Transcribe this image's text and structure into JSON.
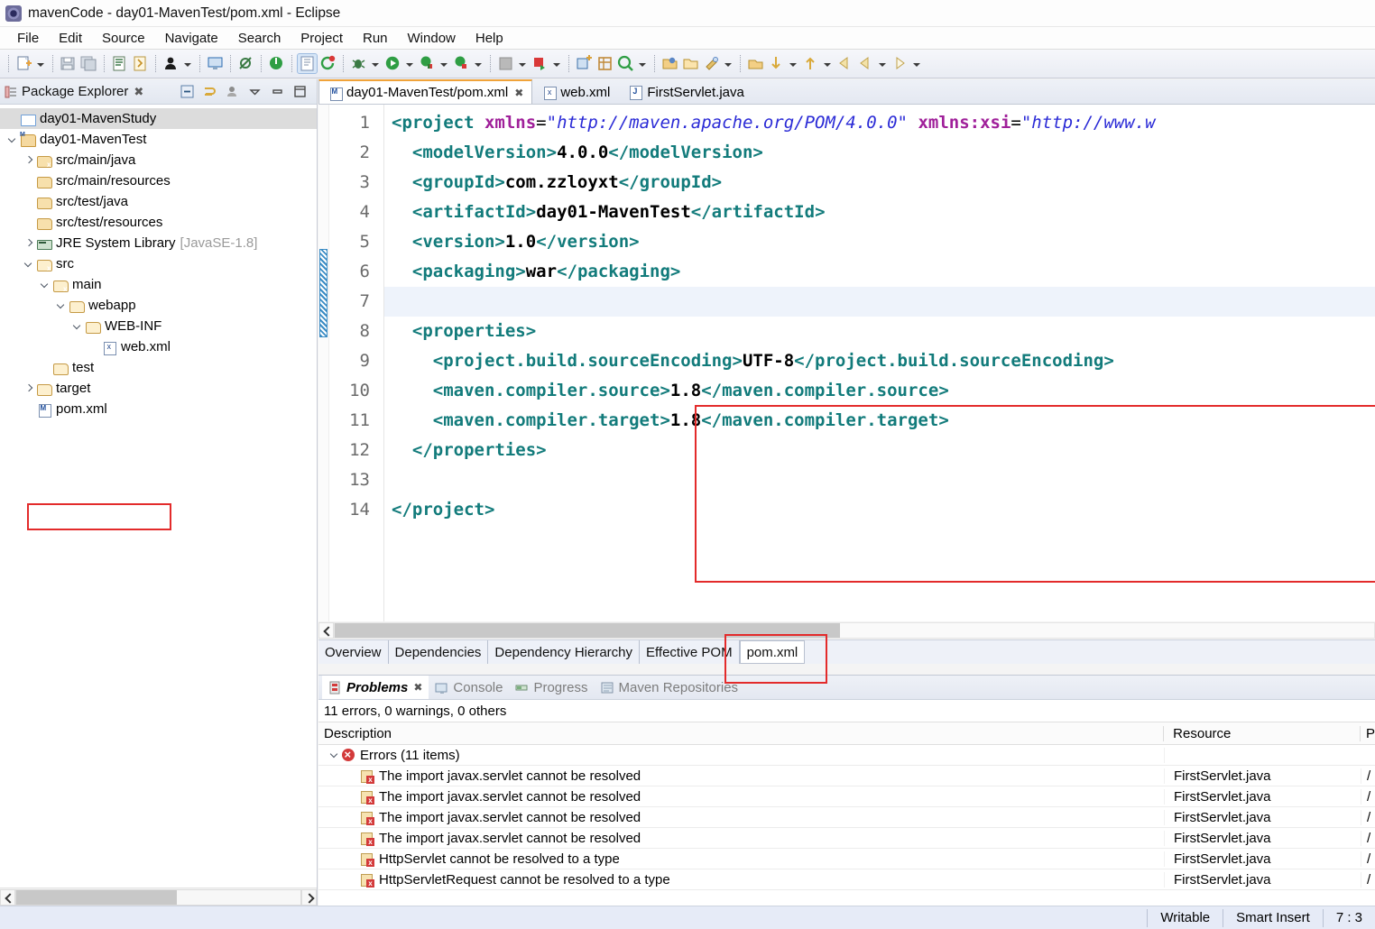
{
  "window": {
    "title": "mavenCode - day01-MavenTest/pom.xml - Eclipse",
    "app_icon": "eclipse-icon"
  },
  "menubar": {
    "items": [
      "File",
      "Edit",
      "Source",
      "Navigate",
      "Search",
      "Project",
      "Run",
      "Window",
      "Help"
    ]
  },
  "toolbar": {
    "groups": [
      [
        "new-wizard-icon",
        "dropdown-arrow"
      ],
      [
        "save-icon",
        "save-all-icon"
      ],
      [
        "print-icon",
        "build-icon"
      ],
      [
        "person-icon",
        "dropdown-arrow"
      ],
      [
        "console-icon"
      ],
      [
        "skip-breakpoints-icon"
      ],
      [
        "terminate-icon"
      ],
      [
        "coverage-icon",
        "refresh-icon"
      ],
      [
        "debug-icon",
        "dropdown-arrow"
      ],
      [
        "run-icon",
        "dropdown-arrow"
      ],
      [
        "run-as-icon",
        "dropdown-arrow"
      ],
      [
        "external-tools-icon",
        "dropdown-arrow"
      ],
      [
        "server-icon",
        "dropdown-arrow"
      ],
      [
        "publish-icon",
        "dropdown-arrow"
      ],
      [
        "new-class-icon",
        "new-package-icon"
      ],
      [
        "search-icon",
        "dropdown-arrow"
      ],
      [
        "open-type-icon",
        "open-folder-icon",
        "open-task-icon",
        "dropdown-arrow"
      ],
      [
        "open-resource-icon"
      ],
      [
        "prev-annotation-icon",
        "dropdown-arrow"
      ],
      [
        "next-annotation-icon",
        "dropdown-arrow"
      ],
      [
        "back-icon",
        "forward-icon",
        "dropdown-arrow"
      ],
      [
        "forward-nav-icon",
        "dropdown-arrow"
      ]
    ]
  },
  "explorer": {
    "title": "Package Explorer",
    "close_glyph": "✖",
    "tools": [
      "collapse-all-icon",
      "link-with-editor-icon",
      "focus-icon",
      "view-menu-icon",
      "minimize-icon",
      "maximize-icon"
    ],
    "tree": [
      {
        "label": "day01-MavenStudy",
        "sub": "",
        "indent": 0,
        "twist": "none",
        "icon": "ic-folder-plain",
        "selected": true
      },
      {
        "label": "day01-MavenTest",
        "sub": "",
        "indent": 0,
        "twist": "down",
        "icon": "ic-maven-proj",
        "selected": false
      },
      {
        "label": "src/main/java",
        "sub": "",
        "indent": 1,
        "twist": "right",
        "icon": "ic-pkgfolder badge-err",
        "selected": false
      },
      {
        "label": "src/main/resources",
        "sub": "",
        "indent": 1,
        "twist": "none",
        "icon": "ic-pkgfolder",
        "selected": false
      },
      {
        "label": "src/test/java",
        "sub": "",
        "indent": 1,
        "twist": "none",
        "icon": "ic-pkgfolder",
        "selected": false
      },
      {
        "label": "src/test/resources",
        "sub": "",
        "indent": 1,
        "twist": "none",
        "icon": "ic-pkgfolder",
        "selected": false
      },
      {
        "label": "JRE System Library",
        "sub": "[JavaSE-1.8]",
        "indent": 1,
        "twist": "right",
        "icon": "ic-jre",
        "selected": false
      },
      {
        "label": "src",
        "sub": "",
        "indent": 1,
        "twist": "down",
        "icon": "ic-folder badge-err",
        "selected": false
      },
      {
        "label": "main",
        "sub": "",
        "indent": 2,
        "twist": "down",
        "icon": "ic-folder badge-err",
        "selected": false
      },
      {
        "label": "webapp",
        "sub": "",
        "indent": 3,
        "twist": "down",
        "icon": "ic-folder",
        "selected": false
      },
      {
        "label": "WEB-INF",
        "sub": "",
        "indent": 4,
        "twist": "down",
        "icon": "ic-folder",
        "selected": false
      },
      {
        "label": "web.xml",
        "sub": "",
        "indent": 5,
        "twist": "none",
        "icon": "ic-xml",
        "selected": false
      },
      {
        "label": "test",
        "sub": "",
        "indent": 2,
        "twist": "none",
        "icon": "ic-folder",
        "selected": false
      },
      {
        "label": "target",
        "sub": "",
        "indent": 1,
        "twist": "right",
        "icon": "ic-folder",
        "selected": false
      },
      {
        "label": "pom.xml",
        "sub": "",
        "indent": 1,
        "twist": "none",
        "icon": "ic-pom",
        "selected": false
      }
    ]
  },
  "editor": {
    "tabs": [
      {
        "label": "day01-MavenTest/pom.xml",
        "icon": "ic-pom",
        "active": true,
        "close_glyph": "✖"
      },
      {
        "label": "web.xml",
        "icon": "ic-xml",
        "active": false,
        "close_glyph": ""
      },
      {
        "label": "FirstServlet.java",
        "icon": "ic-java",
        "active": false,
        "close_glyph": ""
      }
    ],
    "line_numbers": [
      "1",
      "2",
      "3",
      "4",
      "5",
      "6",
      "7",
      "8",
      "9",
      "10",
      "11",
      "12",
      "13",
      "14"
    ],
    "folds": [
      true,
      false,
      false,
      false,
      false,
      false,
      true,
      true,
      false,
      false,
      false,
      false,
      false,
      false
    ],
    "lines": [
      "<project xmlns=\"http://maven.apache.org/POM/4.0.0\" xmlns:xsi=\"http://www.w",
      "  <modelVersion>4.0.0</modelVersion>",
      "  <groupId>com.zzloyxt</groupId>",
      "  <artifactId>day01-MavenTest</artifactId>",
      "  <version>1.0</version>",
      "  <packaging>war</packaging>",
      "",
      "  <properties>",
      "    <project.build.sourceEncoding>UTF-8</project.build.sourceEncoding>",
      "    <maven.compiler.source>1.8</maven.compiler.source>",
      "    <maven.compiler.target>1.8</maven.compiler.target>",
      "  </properties>",
      "",
      "</project>"
    ],
    "bottom_tabs": [
      {
        "label": "Overview",
        "active": false
      },
      {
        "label": "Dependencies",
        "active": false
      },
      {
        "label": "Dependency Hierarchy",
        "active": false
      },
      {
        "label": "Effective POM",
        "active": false
      },
      {
        "label": "pom.xml",
        "active": true
      }
    ],
    "highlight_color": "#e32b2b"
  },
  "problems": {
    "tabs": [
      {
        "label": "Problems",
        "icon": "problems-icon",
        "active": true,
        "close_glyph": "✖"
      },
      {
        "label": "Console",
        "icon": "console-icon",
        "active": false,
        "close_glyph": ""
      },
      {
        "label": "Progress",
        "icon": "progress-icon",
        "active": false,
        "close_glyph": ""
      },
      {
        "label": "Maven Repositories",
        "icon": "maven-repositories-icon",
        "active": false,
        "close_glyph": ""
      }
    ],
    "summary": "11 errors, 0 warnings, 0 others",
    "columns": [
      "Description",
      "Resource",
      "P"
    ],
    "group": {
      "label": "Errors (11 items)",
      "twist": "down"
    },
    "rows": [
      {
        "description": "The import javax.servlet cannot be resolved",
        "resource": "FirstServlet.java",
        "path": "/"
      },
      {
        "description": "The import javax.servlet cannot be resolved",
        "resource": "FirstServlet.java",
        "path": "/"
      },
      {
        "description": "The import javax.servlet cannot be resolved",
        "resource": "FirstServlet.java",
        "path": "/"
      },
      {
        "description": "The import javax.servlet cannot be resolved",
        "resource": "FirstServlet.java",
        "path": "/"
      },
      {
        "description": "HttpServlet cannot be resolved to a type",
        "resource": "FirstServlet.java",
        "path": "/"
      },
      {
        "description": "HttpServletRequest cannot be resolved to a type",
        "resource": "FirstServlet.java",
        "path": "/"
      }
    ]
  },
  "statusbar": {
    "writable": "Writable",
    "insert_mode": "Smart Insert",
    "position": "7 : 3"
  }
}
